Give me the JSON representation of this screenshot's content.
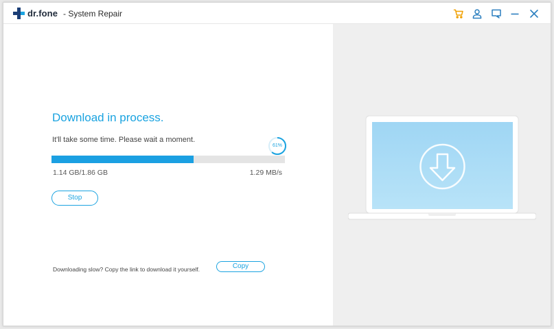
{
  "window": {
    "brand": "dr.fone",
    "title": "- System Repair",
    "controls": {
      "cart_icon": "cart-icon",
      "account_icon": "user-icon",
      "feedback_icon": "chat-icon",
      "minimize_icon": "minimize-icon",
      "close_icon": "close-icon"
    }
  },
  "download": {
    "heading": "Download in process.",
    "subtext": "It'll take some time. Please wait a moment.",
    "percent_label": "61%",
    "progress": 0.61,
    "downloaded": "1.14 GB/1.86 GB",
    "speed": "1.29 MB/s",
    "stop_label": "Stop"
  },
  "footer": {
    "slow_text": "Downloading slow? Copy the link to download it yourself.",
    "copy_label": "Copy"
  },
  "colors": {
    "accent": "#1aa3e0",
    "cart": "#f0a000",
    "icons": "#2b7fbf",
    "screen": "#a6daf5"
  },
  "illustration": {
    "icon": "download-arrow-icon"
  }
}
